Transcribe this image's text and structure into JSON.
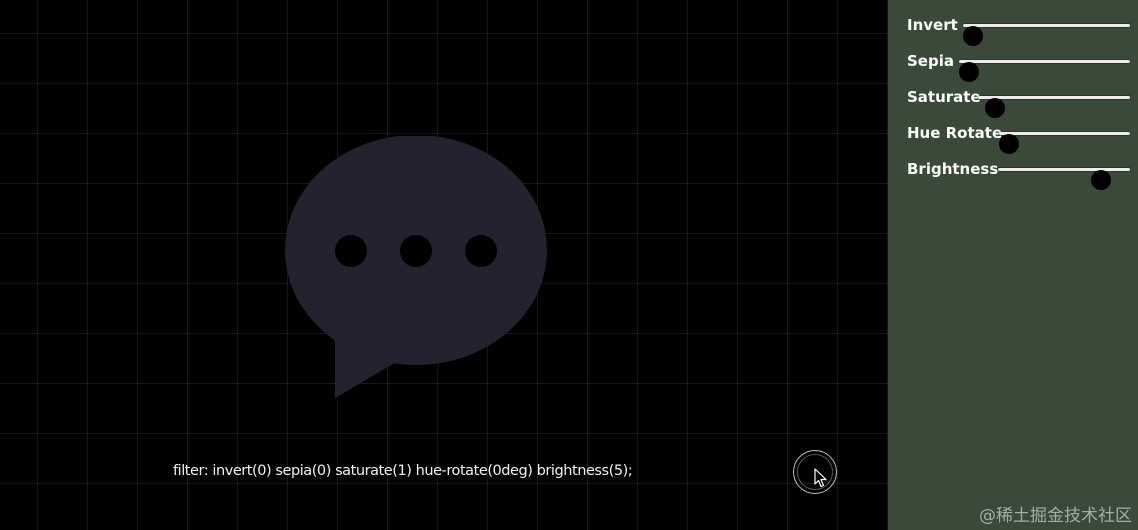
{
  "preview": {
    "filter_text": "filter: invert(0) sepia(0) saturate(1) hue-rotate(0deg) brightness(5);",
    "bubble_icon": "chat-bubble-ellipsis-icon",
    "bubble_color": "#24222f"
  },
  "controls": [
    {
      "id": "invert",
      "label": "Invert",
      "value": 0,
      "min": 0,
      "max": 1
    },
    {
      "id": "sepia",
      "label": "Sepia",
      "value": 0,
      "min": 0,
      "max": 1
    },
    {
      "id": "saturate",
      "label": "Saturate",
      "value": 1,
      "min": 0,
      "max": 20
    },
    {
      "id": "hue-rotate",
      "label": "Hue Rotate",
      "value": 0,
      "min": 0,
      "max": 360
    },
    {
      "id": "brightness",
      "label": "Brightness",
      "value": 5,
      "min": 0,
      "max": 6
    }
  ],
  "watermark": "@稀土掘金技术社区",
  "colors": {
    "panel_background": "#3b493b",
    "stage_background": "#000000",
    "slider_thumb": "#000000",
    "slider_track": "#ececec"
  }
}
